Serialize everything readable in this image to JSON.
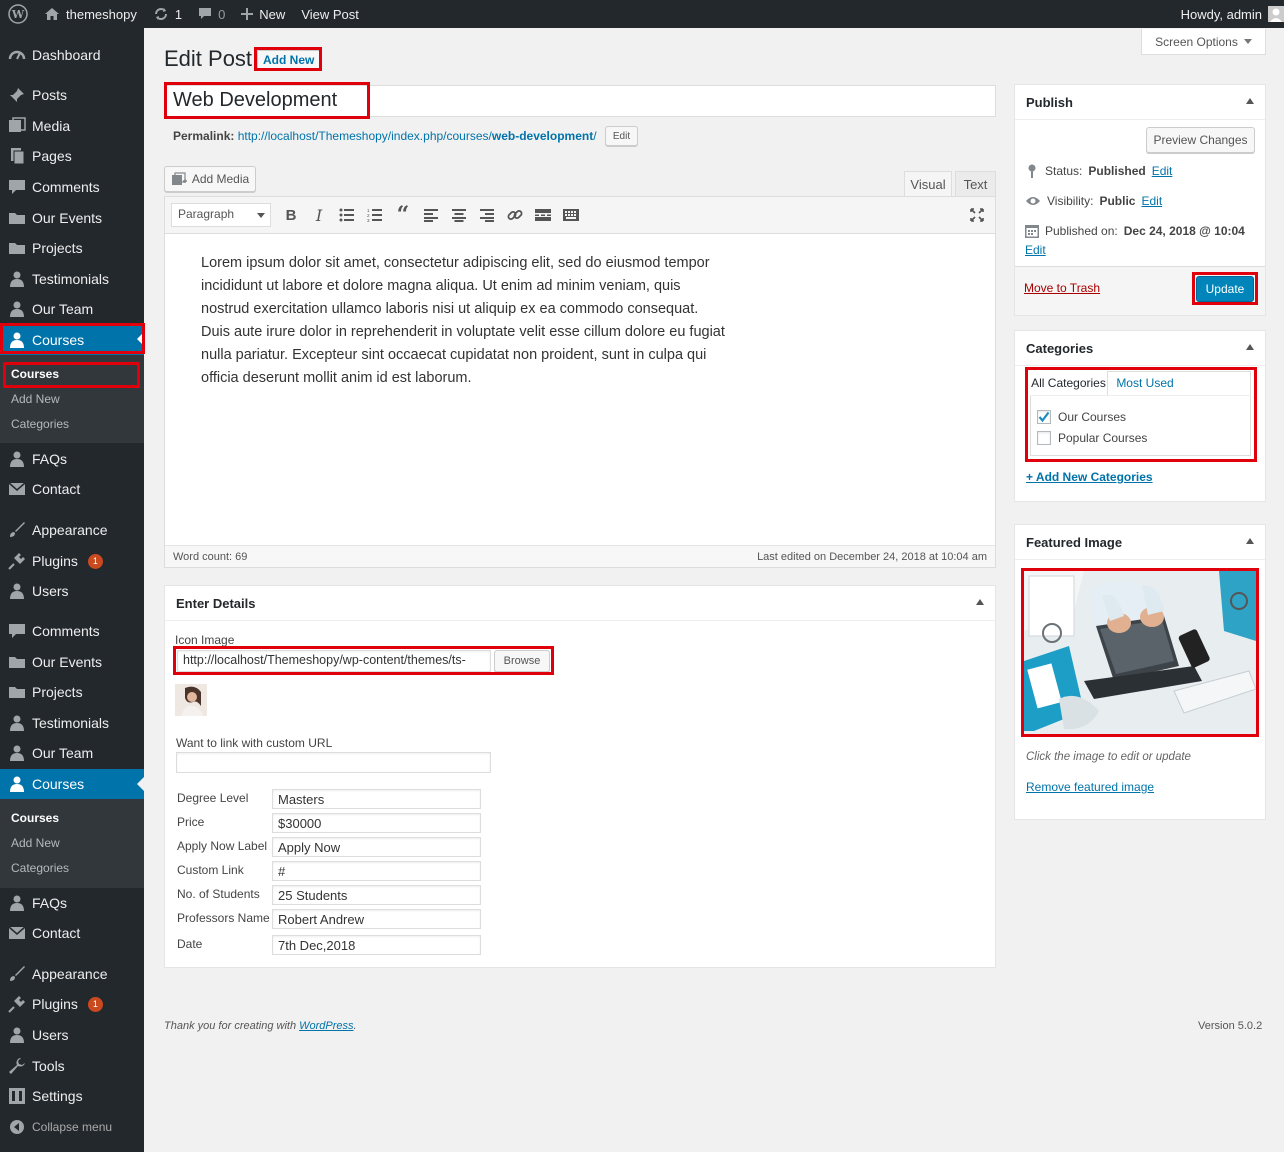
{
  "adminbar": {
    "site_name": "themeshopy",
    "updates_count": "1",
    "comments_count": "0",
    "new_label": "New",
    "view_post_label": "View Post",
    "howdy": "Howdy, admin"
  },
  "sidebar": {
    "dashboard": "Dashboard",
    "posts": "Posts",
    "media": "Media",
    "pages": "Pages",
    "comments": "Comments",
    "our_events": "Our Events",
    "projects": "Projects",
    "testimonials": "Testimonials",
    "our_team": "Our Team",
    "courses": "Courses",
    "sub_courses": "Courses",
    "sub_add_new": "Add New",
    "sub_categories": "Categories",
    "faqs": "FAQs",
    "contact": "Contact",
    "appearance": "Appearance",
    "plugins": "Plugins",
    "plugins_badge": "1",
    "users": "Users",
    "tools": "Tools",
    "settings": "Settings",
    "collapse": "Collapse menu"
  },
  "header": {
    "title": "Edit Post",
    "add_new": "Add New",
    "screen_options": "Screen Options"
  },
  "post": {
    "title": "Web Development",
    "permalink_label": "Permalink:",
    "permalink_base": "http://localhost/Themeshopy/index.php/courses/",
    "permalink_slug": "web-development",
    "permalink_end": "/",
    "permalink_edit": "Edit"
  },
  "editor": {
    "add_media": "Add Media",
    "tab_visual": "Visual",
    "tab_text": "Text",
    "paragraph": "Paragraph",
    "content": "Lorem ipsum dolor sit amet, consectetur adipiscing elit, sed do eiusmod tempor incididunt ut labore et dolore magna aliqua. Ut enim ad minim veniam, quis nostrud exercitation ullamco laboris nisi ut aliquip ex ea commodo consequat. Duis aute irure dolor in reprehenderit in voluptate velit esse cillum dolore eu fugiat nulla pariatur. Excepteur sint occaecat cupidatat non proident, sunt in culpa qui officia deserunt mollit anim id est laborum.",
    "word_count": "Word count: 69",
    "last_edited": "Last edited on December 24, 2018 at 10:04 am"
  },
  "details": {
    "title": "Enter Details",
    "icon_image_label": "Icon Image",
    "icon_image_value": "http://localhost/Themeshopy/wp-content/themes/ts-",
    "browse": "Browse",
    "custom_url_label": "Want to link with custom URL",
    "custom_url_value": "",
    "rows": [
      {
        "label": "Degree Level",
        "value": "Masters"
      },
      {
        "label": "Price",
        "value": "$30000"
      },
      {
        "label": "Apply Now Label",
        "value": "Apply Now"
      },
      {
        "label": "Custom Link",
        "value": "#"
      },
      {
        "label": "No. of Students",
        "value": "25 Students"
      },
      {
        "label": "Professors Name",
        "value": "Robert Andrew"
      },
      {
        "label": "Date",
        "value": "7th Dec,2018"
      }
    ]
  },
  "publish": {
    "title": "Publish",
    "preview": "Preview Changes",
    "status_label": "Status:",
    "status_value": "Published",
    "visibility_label": "Visibility:",
    "visibility_value": "Public",
    "published_label": "Published on:",
    "published_value": "Dec 24, 2018 @ 10:04",
    "edit": "Edit",
    "trash": "Move to Trash",
    "update": "Update"
  },
  "categories": {
    "title": "Categories",
    "tab_all": "All Categories",
    "tab_most_used": "Most Used",
    "items": [
      {
        "label": "Our Courses",
        "checked": true
      },
      {
        "label": "Popular Courses",
        "checked": false
      }
    ],
    "add_new": "+ Add New Categories"
  },
  "featured": {
    "title": "Featured Image",
    "hint": "Click the image to edit or update",
    "remove": "Remove featured image"
  },
  "footer": {
    "thanks_prefix": "Thank you for creating with ",
    "wordpress": "WordPress",
    "thanks_suffix": ".",
    "version": "Version 5.0.2"
  },
  "colors": {
    "admin_bar": "#23282d",
    "accent": "#0073aa",
    "highlight_box": "#e0000b"
  }
}
